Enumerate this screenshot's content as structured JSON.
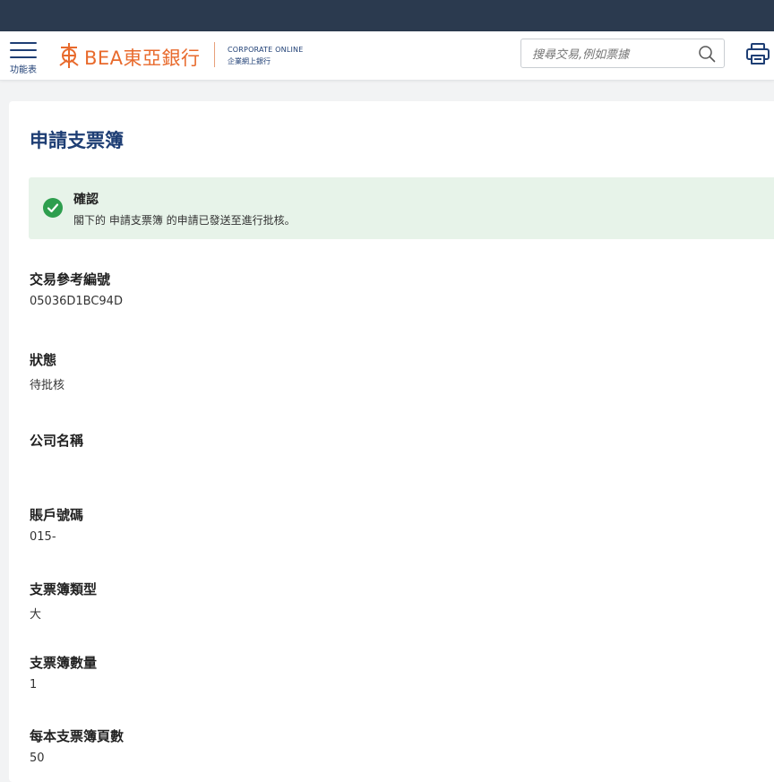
{
  "header": {
    "menu_label": "功能表",
    "logo_text": "BEA東亞銀行",
    "corporate_line1": "CORPORATE ONLINE",
    "corporate_line2": "企業網上銀行",
    "search_placeholder": "搜尋交易,例如票據",
    "brand_color": "#e86a2c",
    "primary_color": "#1e3e74"
  },
  "page": {
    "title": "申請支票簿"
  },
  "alert": {
    "title": "確認",
    "message": "閣下的 申請支票簿 的申請已發送至進行批核。",
    "color": "#2e9e4e"
  },
  "fields": [
    {
      "label": "交易參考編號",
      "value": "05036D1BC94D"
    },
    {
      "label": "狀態",
      "value": "待批核"
    },
    {
      "label": "公司名稱",
      "value": ""
    },
    {
      "label": "賬戶號碼",
      "value": "015-"
    },
    {
      "label": "支票簿類型",
      "value": "大"
    },
    {
      "label": "支票簿數量",
      "value": "1"
    },
    {
      "label": "每本支票簿頁數",
      "value": "50"
    }
  ]
}
